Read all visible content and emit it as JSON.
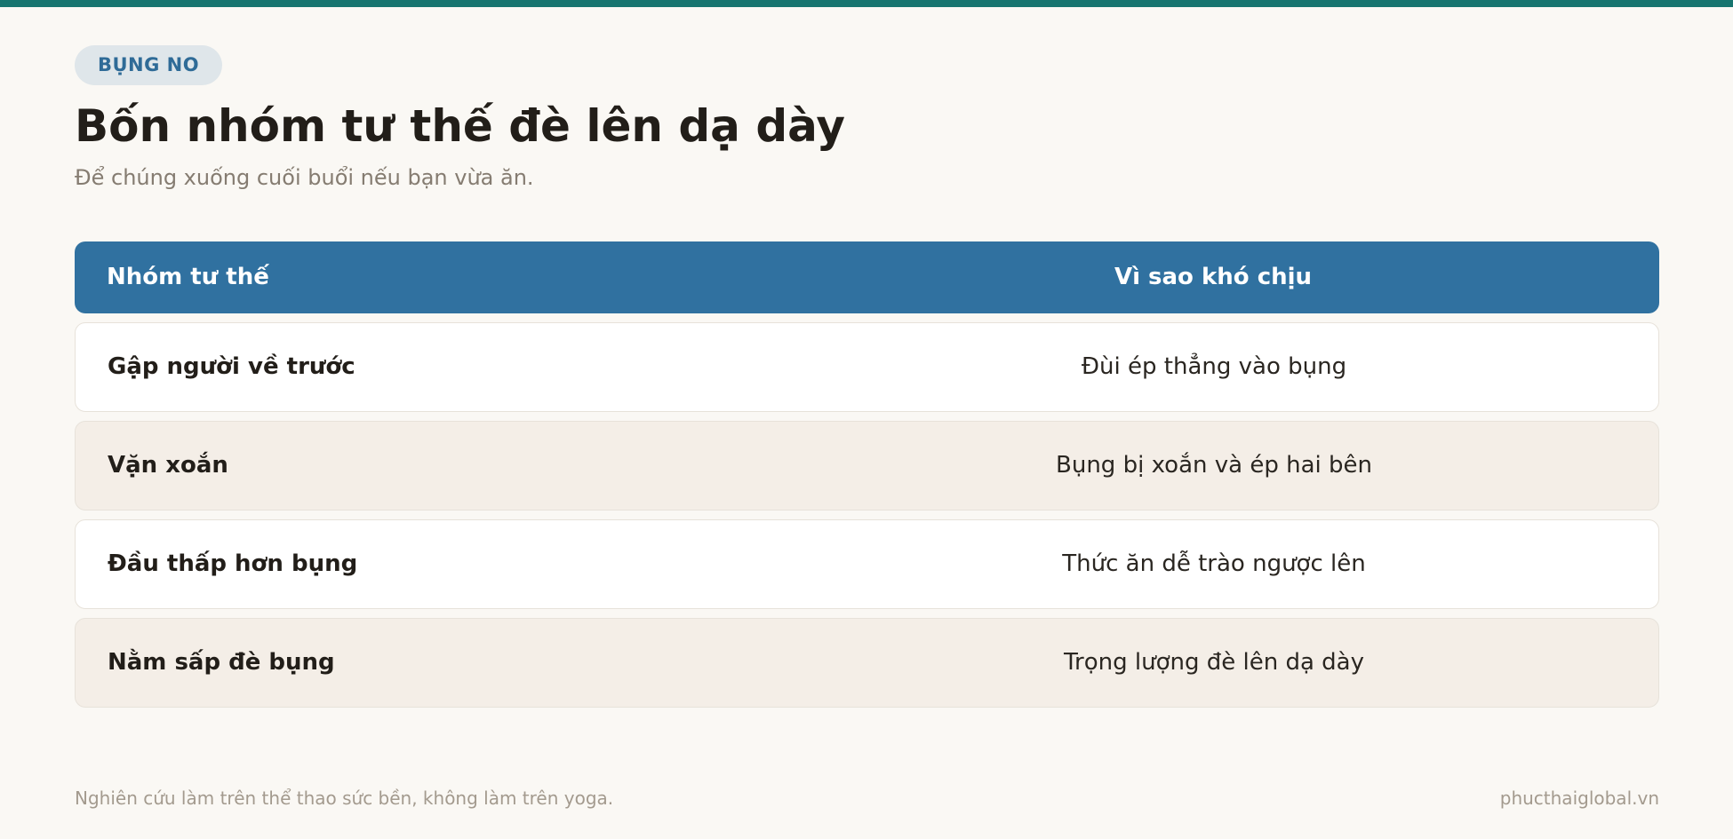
{
  "header": {
    "badge": "BỤNG NO",
    "title": "Bốn nhóm tư thế đè lên dạ dày",
    "subtitle": "Để chúng xuống cuối buổi nếu bạn vừa ăn."
  },
  "table": {
    "columns": [
      "Nhóm tư thế",
      "Vì sao khó chịu"
    ],
    "rows": [
      {
        "group": "Gập người về trước",
        "reason": "Đùi ép thẳng vào bụng"
      },
      {
        "group": "Vặn xoắn",
        "reason": "Bụng bị xoắn và ép hai bên"
      },
      {
        "group": "Đầu thấp hơn bụng",
        "reason": "Thức ăn dễ trào ngược lên"
      },
      {
        "group": "Nằm sấp đè bụng",
        "reason": "Trọng lượng đè lên dạ dày"
      }
    ]
  },
  "footer": {
    "note": "Nghiên cứu làm trên thể thao sức bền, không làm trên yoga.",
    "site": "phucthaiglobal.vn"
  },
  "colors": {
    "accent_top_bar": "#17756f",
    "header_row": "#3071a0",
    "badge_bg": "#dfe6ea",
    "badge_text": "#2f6b97",
    "row_alt": "#f4eee7",
    "page_bg": "#faf8f4"
  }
}
